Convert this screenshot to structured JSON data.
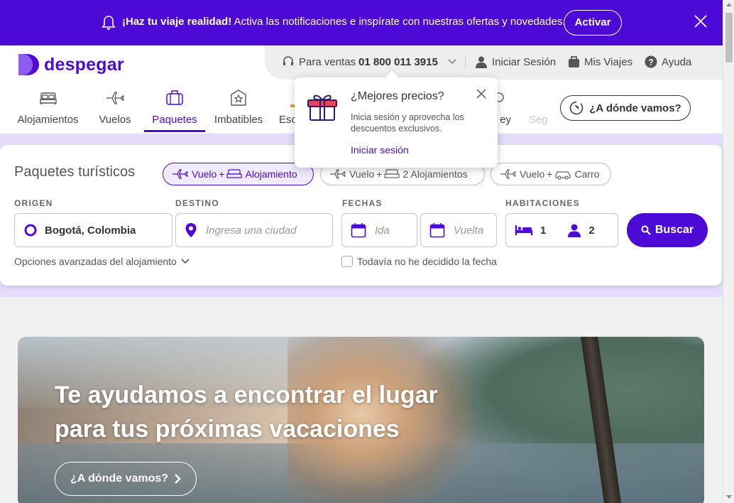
{
  "banner": {
    "bold_text": "¡Haz tu viaje realidad!",
    "text": " Activa las notificaciones e inspírate con nuestras ofertas y novedades.",
    "button_label": "Activar"
  },
  "header": {
    "logo_text": "despegar",
    "sales_label": "Para ventas",
    "sales_phone": "01 800 011 3915",
    "login_label": "Iniciar Sesión",
    "trips_label": "Mis Viajes",
    "help_label": "Ayuda"
  },
  "nav": {
    "items": [
      {
        "label": "Alojamientos",
        "icon": "bed-icon"
      },
      {
        "label": "Vuelos",
        "icon": "plane-icon"
      },
      {
        "label": "Paquetes",
        "icon": "suitcase-icon"
      },
      {
        "label": "Imbatibles",
        "icon": "tag-building-icon"
      },
      {
        "label": "Esc",
        "icon": "badge-icon"
      },
      {
        "label": "ey",
        "icon": "money-icon"
      },
      {
        "label": "Seg",
        "icon": "shield-icon"
      }
    ],
    "active": "Paquetes",
    "whereto_label": "¿A dónde vamos?"
  },
  "popover": {
    "title": "¿Mejores precios?",
    "body": "Inicia sesión y aprovecha los descuentos exclusivos.",
    "link_label": "Iniciar sesión"
  },
  "search": {
    "title": "Paquetes turísticos",
    "chips": [
      {
        "vuelo": "Vuelo",
        "plus": "+",
        "other": "Alojamiento",
        "active": true
      },
      {
        "vuelo": "Vuelo",
        "plus": "+",
        "other": "2 Alojamientos",
        "active": false
      },
      {
        "vuelo": "Vuelo",
        "plus": "+",
        "other": "Carro",
        "active": false
      }
    ],
    "labels": {
      "origen": "ORIGEN",
      "destino": "DESTINO",
      "fechas": "FECHAS",
      "habitaciones": "HABITACIONES"
    },
    "origin_value": "Bogotá, Colombia",
    "destination_placeholder": "Ingresa una ciudad",
    "ida_placeholder": "Ida",
    "vuelta_placeholder": "Vuelta",
    "rooms": "1",
    "people": "2",
    "search_button": "Buscar",
    "advanced_options": "Opciones avanzadas del alojamiento",
    "no_date_label": "Todavía no he decidido la fecha"
  },
  "hero": {
    "title_line1": "Te ayudamos a encontrar el lugar",
    "title_line2": "para tus próximas vacaciones",
    "button_label": "¿A dónde vamos?"
  },
  "colors": {
    "brand": "#4d0ad6",
    "lavender": "#e4dcfa"
  }
}
